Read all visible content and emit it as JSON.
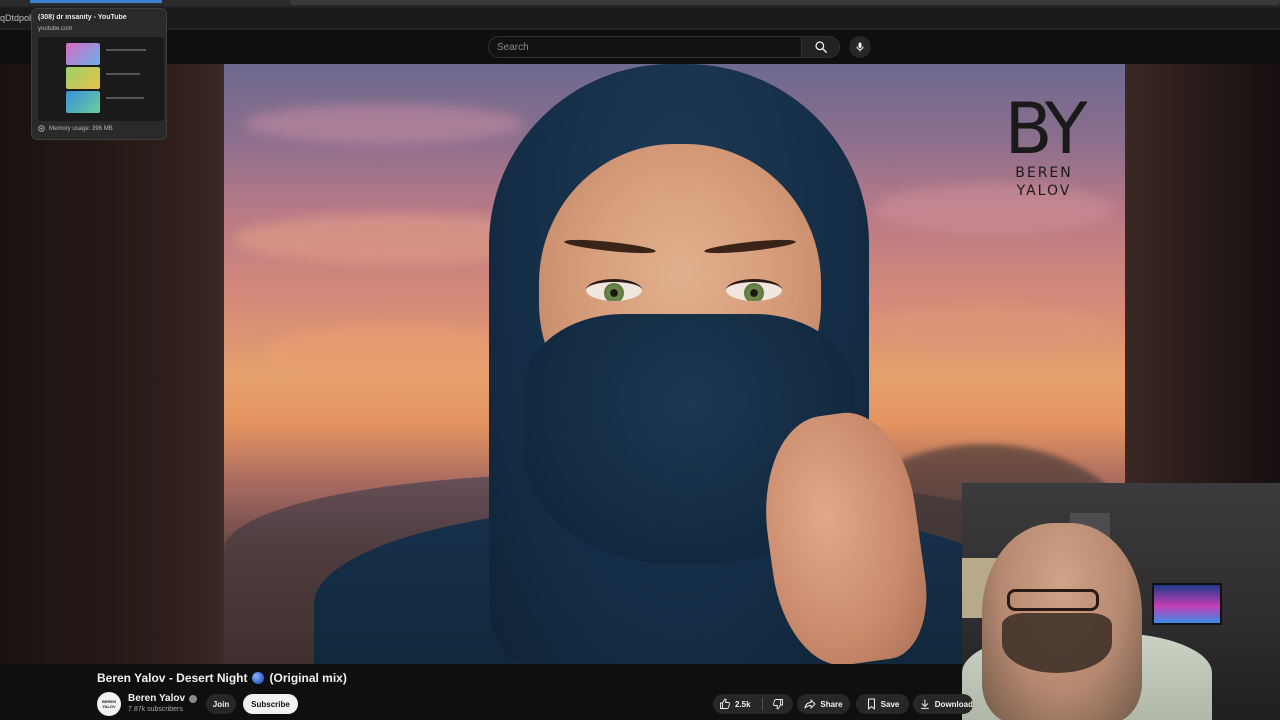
{
  "browser": {
    "address_fragment": "qDtdpob"
  },
  "tab_preview": {
    "title": "(308) dr insanity - YouTube",
    "domain": "youtube.com",
    "memory": "Memory usage: 396 MB"
  },
  "header": {
    "search_placeholder": "Search",
    "icons": [
      "search-icon",
      "microphone-icon"
    ]
  },
  "video": {
    "watermark": {
      "logo": "BY",
      "line1": "BEREN",
      "line2": "YALOV"
    },
    "title": "Beren Yalov - Desert Night",
    "title_suffix": "(Original mix)"
  },
  "channel": {
    "avatar_line1": "BEREN",
    "avatar_line2": "YALOV",
    "name": "Beren Yalov",
    "subscribers": "7.87k subscribers",
    "join_label": "Join",
    "subscribe_label": "Subscribe"
  },
  "actions": {
    "likes": "2.5k",
    "share_label": "Share",
    "save_label": "Save",
    "download_label": "Download"
  },
  "colors": {
    "background": "#0f0f0f",
    "pill": "#272727",
    "subscribe": "#f1f1f1",
    "hijab": "#16304a"
  }
}
